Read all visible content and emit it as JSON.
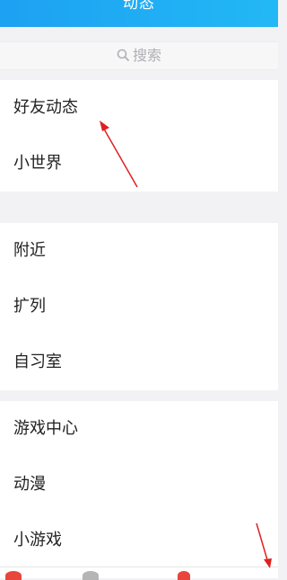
{
  "header": {
    "title": "动态"
  },
  "search": {
    "placeholder": "搜索",
    "icon": "search-icon"
  },
  "groups": [
    {
      "items": [
        {
          "label": "好友动态"
        },
        {
          "label": "小世界"
        }
      ]
    },
    {
      "items": [
        {
          "label": "附近"
        },
        {
          "label": "扩列"
        },
        {
          "label": "自习室"
        }
      ]
    },
    {
      "items": [
        {
          "label": "游戏中心"
        },
        {
          "label": "动漫"
        },
        {
          "label": "小游戏"
        }
      ]
    }
  ],
  "colors": {
    "header_start": "#1da1f2",
    "header_end": "#22b8f5",
    "annotation_arrow": "#e02020",
    "tab_hint_red": "#e8453c",
    "tab_hint_gray": "#b5b5b5"
  }
}
